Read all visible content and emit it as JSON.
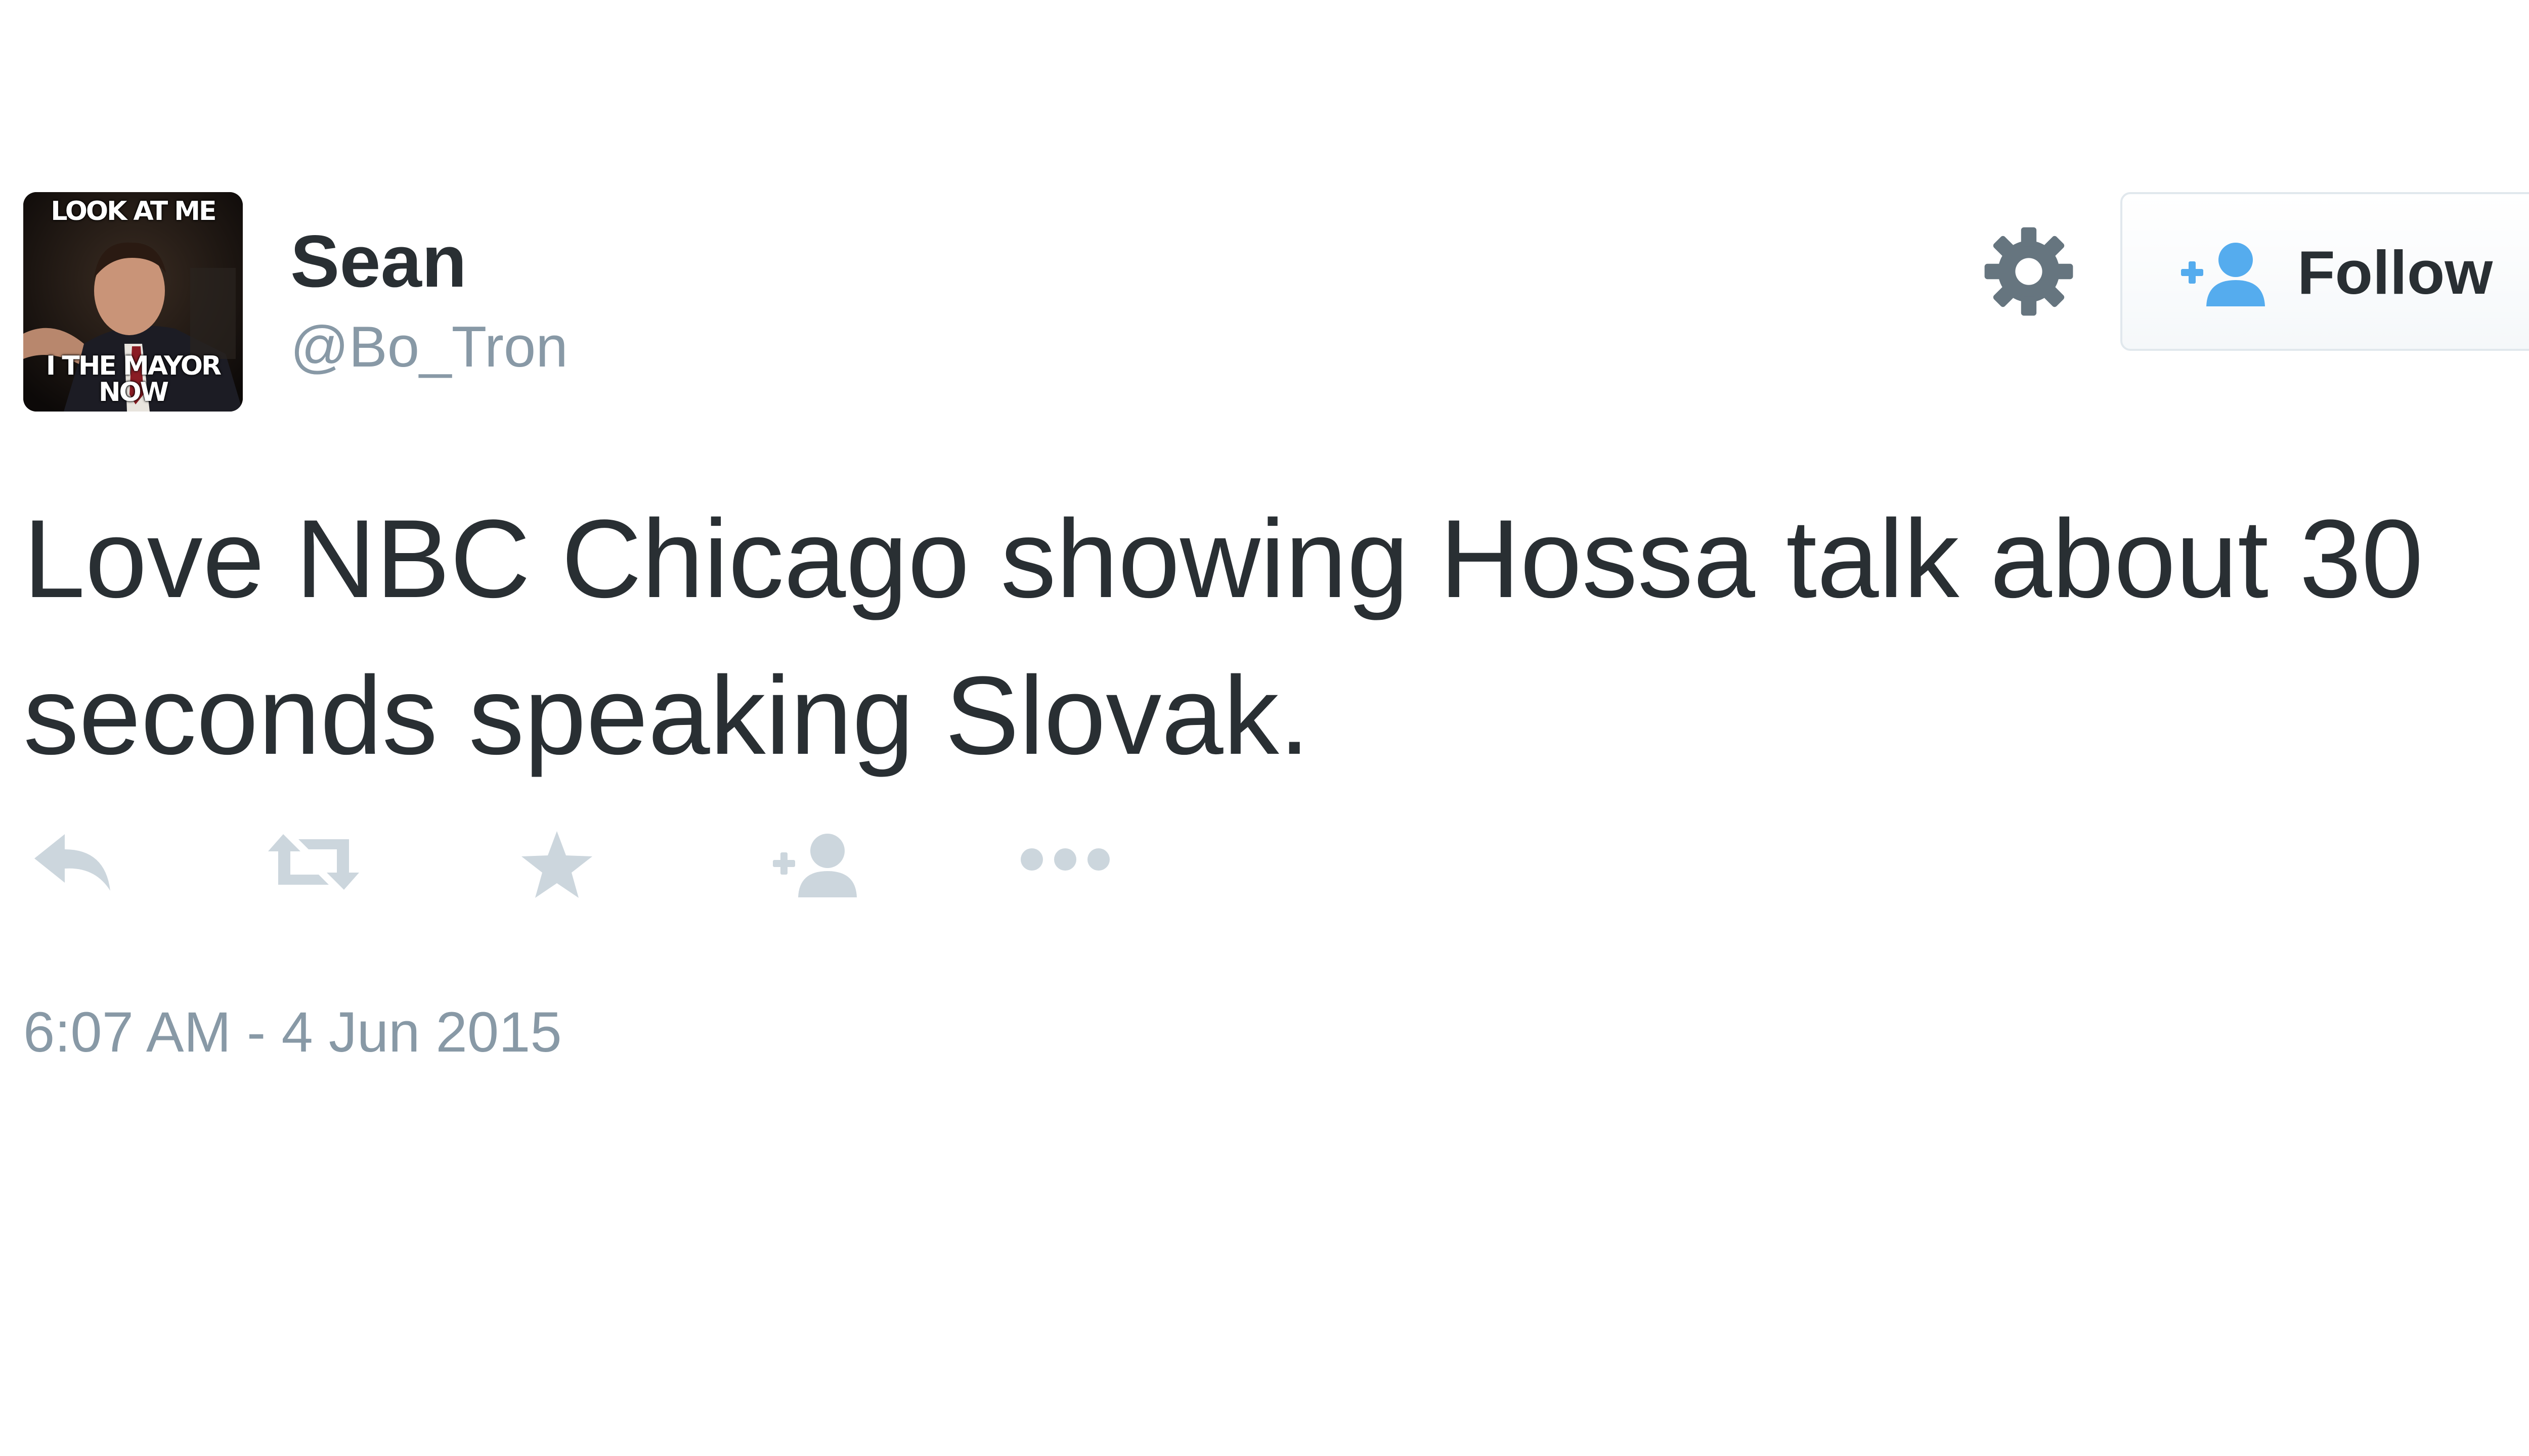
{
  "user": {
    "name": "Sean",
    "handle": "@Bo_Tron",
    "avatar_caption_top": "LOOK AT ME",
    "avatar_caption_bottom": "I THE MAYOR NOW"
  },
  "header": {
    "settings_icon": "gear-icon",
    "follow_label": "Follow",
    "follow_icon": "add-user-icon"
  },
  "tweet": {
    "text": "Love NBC Chicago showing Hossa talk about 30 seconds speaking Slovak.",
    "timestamp": "6:07 AM - 4 Jun 2015"
  },
  "actions": [
    {
      "icon": "reply-icon"
    },
    {
      "icon": "retweet-icon"
    },
    {
      "icon": "favorite-star-icon"
    },
    {
      "icon": "follow-user-icon"
    },
    {
      "icon": "more-options-icon"
    }
  ],
  "colors": {
    "text": "#292f33",
    "muted": "#8899a6",
    "action_icon": "#ccd6dd",
    "follow_blue": "#55acee",
    "button_border": "#e1e8ed",
    "gear": "#66757f"
  }
}
